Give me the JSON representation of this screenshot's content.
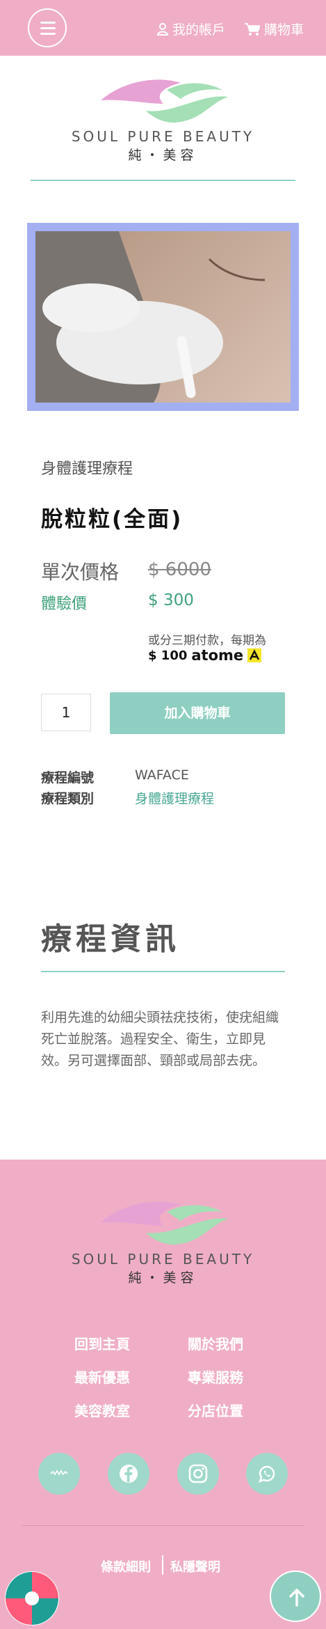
{
  "header": {
    "account_label": "我的帳戶",
    "cart_label": "購物車",
    "brand_en": "SOUL PURE BEAUTY",
    "brand_zh": "純・美容"
  },
  "product": {
    "category": "身體護理療程",
    "title": "脫粒粒(全面)",
    "single_price_label": "單次價格",
    "single_price": "$ 6000",
    "trial_price_label": "體驗價",
    "trial_price": "$ 300",
    "installment_text": "或分三期付款，每期為",
    "installment_amount": "$ 100",
    "installment_provider": "atome",
    "quantity": "1",
    "add_to_cart_label": "加入購物車",
    "code_label": "療程編號",
    "code_value": "WAFACE",
    "type_label": "療程類別",
    "type_value": "身體護理療程"
  },
  "info": {
    "title": "療程資訊",
    "description": "利用先進的幼細尖頭祛疣技術，使疣組織死亡並脫落。過程安全、衛生，立即見效。另可選擇面部、頸部或局部去疣。"
  },
  "footer": {
    "brand_en": "SOUL PURE BEAUTY",
    "brand_zh": "純・美容",
    "links": [
      "回到主頁",
      "關於我們",
      "最新優惠",
      "專業服務",
      "美容教室",
      "分店位置"
    ],
    "social": [
      "hkwk-icon",
      "facebook-icon",
      "instagram-icon",
      "whatsapp-icon"
    ],
    "terms_label": "條款細則",
    "privacy_label": "私隱聲明"
  },
  "colors": {
    "brand_pink": "#f0aec6",
    "accent_teal": "#8fcfc1",
    "price_green": "#3fa27b",
    "frame_blue": "#a3aff0"
  }
}
